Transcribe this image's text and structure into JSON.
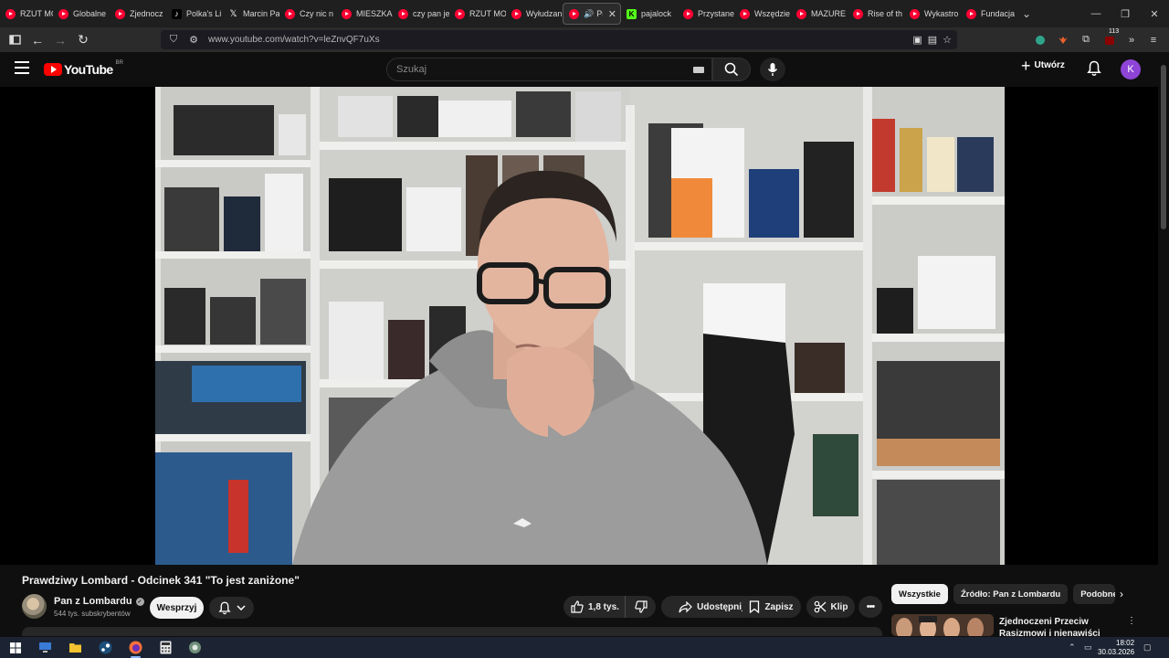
{
  "browser": {
    "tabs": [
      {
        "title": "RZUT MO",
        "icon": "youtube-icon"
      },
      {
        "title": "Globalne",
        "icon": "youtube-icon"
      },
      {
        "title": "Zjednocz",
        "icon": "youtube-icon"
      },
      {
        "title": "Polka's Li",
        "icon": "tiktok-icon"
      },
      {
        "title": "Marcin Pa",
        "icon": "x-icon"
      },
      {
        "title": "Czy nic n",
        "icon": "youtube-icon"
      },
      {
        "title": "MIESZKA",
        "icon": "youtube-icon"
      },
      {
        "title": "czy pan je",
        "icon": "youtube-icon"
      },
      {
        "title": "RZUT MO",
        "icon": "youtube-icon"
      },
      {
        "title": "Wyłudzan",
        "icon": "youtube-icon"
      },
      {
        "title": "Pra",
        "icon": "youtube-icon",
        "active": true
      },
      {
        "title": "pajalock",
        "icon": "kick-icon"
      },
      {
        "title": "Przystane",
        "icon": "youtube-icon"
      },
      {
        "title": "Wszędzie",
        "icon": "youtube-icon"
      },
      {
        "title": "MAZURE",
        "icon": "youtube-icon"
      },
      {
        "title": "Rise of th",
        "icon": "youtube-icon"
      },
      {
        "title": "Wykastro",
        "icon": "youtube-icon"
      },
      {
        "title": "Fundacja",
        "icon": "youtube-icon"
      }
    ],
    "url": "www.youtube.com/watch?v=leZnvQF7uXs",
    "extension_badge": "113"
  },
  "youtube": {
    "logo_text": "YouTube",
    "country_code": "BR",
    "search_placeholder": "Szukaj",
    "create_label": "Utwórz",
    "avatar_letter": "K",
    "accent": "#ff0000"
  },
  "video": {
    "title": "Prawdziwy Lombard - Odcinek 341 \"To jest zaniżone\"",
    "channel": "Pan z Lombardu",
    "subscribers": "544 tys. subskrybentów",
    "support_label": "Wesprzyj",
    "likes": "1,8 tys.",
    "share_label": "Udostępnij",
    "save_label": "Zapisz",
    "clip_label": "Klip"
  },
  "sidebar": {
    "chips": [
      "Wszystkie",
      "Źródło: Pan z Lombardu",
      "Podobne"
    ],
    "recommendation_title": "Zjednoczeni Przeciw Rasizmowi i nienawiści"
  },
  "taskbar": {
    "time": "18:02",
    "date": "30.03.2026"
  }
}
